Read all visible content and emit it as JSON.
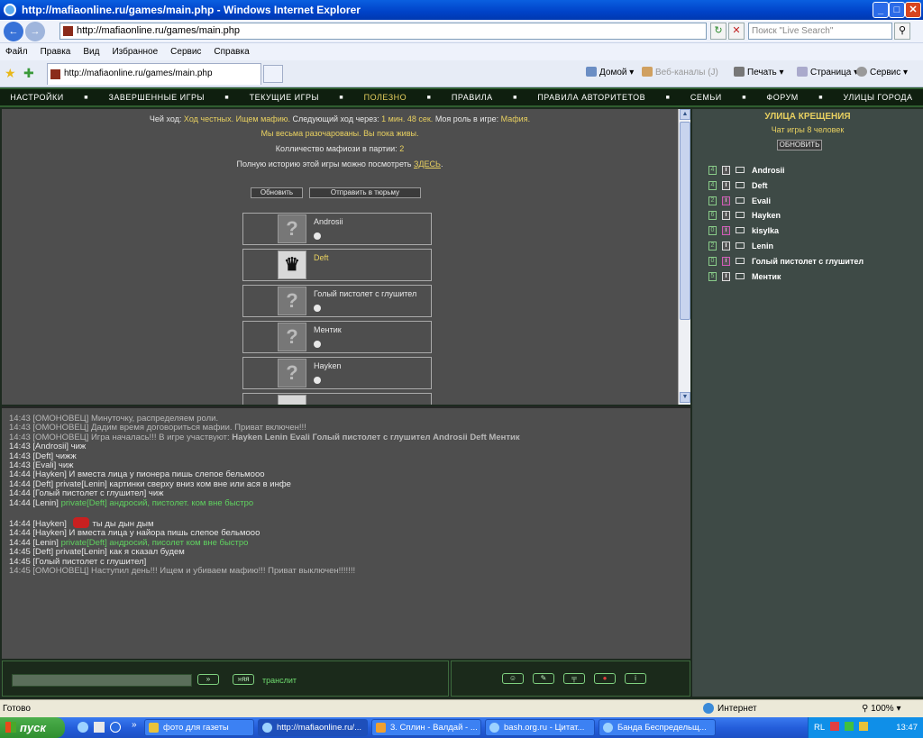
{
  "window": {
    "title": "http://mafiaonline.ru/games/main.php - Windows Internet Explorer"
  },
  "address": {
    "url": "http://mafiaonline.ru/games/main.php",
    "search_placeholder": "Поиск \"Live Search\""
  },
  "menu": [
    "Файл",
    "Правка",
    "Вид",
    "Избранное",
    "Сервис",
    "Справка"
  ],
  "tab": {
    "title": "http://mafiaonline.ru/games/main.php"
  },
  "commands": {
    "home": "Домой",
    "feeds": "Веб-каналы (J)",
    "print": "Печать",
    "page": "Страница",
    "tools": "Сервис"
  },
  "gamenav": [
    "НАСТРОЙКИ",
    "ЗАВЕРШЕННЫЕ ИГРЫ",
    "ТЕКУЩИЕ ИГРЫ",
    "ПОЛЕЗНО",
    "ПРАВИЛА",
    "ПРАВИЛА АВТОРИТЕТОВ",
    "СЕМЬИ",
    "ФОРУМ",
    "УЛИЦЫ ГОРОДА"
  ],
  "gamenav_active": "ПОЛЕЗНО",
  "info": {
    "turn_label": "Чей ход:",
    "turn_value": "Ход честных. Ищем мафию.",
    "next_label": "Следующий ход через:",
    "next_value": "1 мин. 48 сек.",
    "role_label": "Моя роль в игре:",
    "role_value": "Мафия.",
    "status": "Мы весьма разочарованы. Вы пока живы.",
    "mafia_count_label": "Колличество мафиози в партии:",
    "mafia_count": "2",
    "history_text": "Полную историю этой игры можно посмотреть",
    "history_link": "ЗДЕСЬ",
    "history_end": "."
  },
  "buttons": {
    "refresh": "Обновить",
    "jail": "Отправить в тюрьму"
  },
  "players": [
    {
      "name": "Androsii",
      "highlight": false
    },
    {
      "name": "Deft",
      "highlight": true
    },
    {
      "name": "Голый пистолет с глушител",
      "highlight": false
    },
    {
      "name": "Ментик",
      "highlight": false
    },
    {
      "name": "Hayken",
      "highlight": false
    }
  ],
  "chat": [
    {
      "time": "14:43",
      "text": "[ОМОНОВЕЦ] Минуточку, распределяем роли.",
      "style": "sys"
    },
    {
      "time": "14:43",
      "text": "[ОМОНОВЕЦ] Дадим время договориться мафии. Приват включен!!!",
      "style": "sys"
    },
    {
      "time": "14:43",
      "text": "[ОМОНОВЕЦ] Игра началась!!! В игре участвуют:",
      "bold": "Hayken Lenin Evali Голый пистолет с глушител Androsii Deft Ментик",
      "style": "sys"
    },
    {
      "time": "14:43",
      "text": "[Androsii] чиж",
      "style": "norm"
    },
    {
      "time": "14:43",
      "text": "[Deft] чижж",
      "style": "norm"
    },
    {
      "time": "14:43",
      "text": "[Evali] чиж",
      "style": "norm"
    },
    {
      "time": "14:44",
      "text": "[Hayken] И вместа лица у пионера пишь слепое бельмооо",
      "style": "norm"
    },
    {
      "time": "14:44",
      "text": "[Deft] private[Lenin] картинки сверху вниз ком вне или ася в инфе",
      "style": "norm"
    },
    {
      "time": "14:44",
      "text": "[Голый пистолет с глушител] чиж",
      "style": "norm"
    },
    {
      "time": "14:44",
      "text": "[Lenin]",
      "green": "private[Deft] андросий, пистолет. ком вне быстро",
      "style": "norm"
    },
    {
      "time": "14:44",
      "text": "[Hayken]",
      "after": "ты ды дын дым",
      "style": "norm",
      "gap": true
    },
    {
      "time": "14:44",
      "text": "[Hayken] И вместа лица у найора пишь слепое бельмооо",
      "style": "norm"
    },
    {
      "time": "14:44",
      "text": "[Lenin]",
      "green": "private[Deft] андросий, писолет ком вне быстро",
      "style": "norm"
    },
    {
      "time": "14:45",
      "text": "[Deft] private[Lenin] как я сказал будем",
      "style": "norm"
    },
    {
      "time": "14:45",
      "text": "[Голый пистолет с глушител]",
      "style": "norm"
    },
    {
      "time": "14:45",
      "text": "[ОМОНОВЕЦ] Наступил день!!! Ищем и убиваем мафию!!! Приват выключен!!!!!!!",
      "style": "sys"
    }
  ],
  "input": {
    "send": "»",
    "send2": "»яя",
    "translit": "транслит"
  },
  "sidebar": {
    "title": "УЛИЦА КРЕЩЕНИЯ",
    "subtitle": "Чат игры 8 человек",
    "refresh": "ОБНОВИТЬ",
    "players": [
      {
        "num": "4",
        "name": "Androsii",
        "pink": false
      },
      {
        "num": "4",
        "name": "Deft",
        "pink": false
      },
      {
        "num": "2",
        "name": "Evali",
        "pink": true
      },
      {
        "num": "6",
        "name": "Hayken",
        "pink": false
      },
      {
        "num": "0",
        "name": "kisylka",
        "pink": true
      },
      {
        "num": "2",
        "name": "Lenin",
        "pink": false
      },
      {
        "num": "0",
        "name": "Голый пистолет с глушител",
        "pink": true
      },
      {
        "num": "5",
        "name": "Ментик",
        "pink": false
      }
    ]
  },
  "status": {
    "left": "Готово",
    "zone": "Интернет",
    "zoom": "100%"
  },
  "taskbar": {
    "start": "пуск",
    "tasks": [
      "фото для газеты",
      "http://mafiaonline.ru/...",
      "3. Сплин - Валдай - ...",
      "bash.org.ru - Цитат...",
      "Банда Беспредельщ..."
    ],
    "lang": "RL",
    "time": "13:47"
  }
}
